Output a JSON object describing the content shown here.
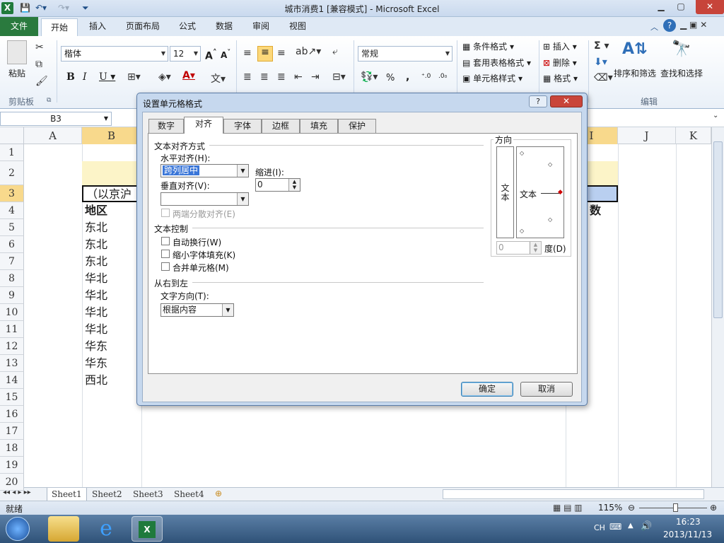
{
  "window": {
    "title": "城市消费1 [兼容模式] - Microsoft Excel",
    "minimize": "▁",
    "maximize": "▢",
    "close": "✕"
  },
  "ribbon_tabs": [
    "文件",
    "开始",
    "插入",
    "页面布局",
    "公式",
    "数据",
    "审阅",
    "视图"
  ],
  "ribbon": {
    "paste": "粘贴",
    "clipboard_group": "剪贴板",
    "font_name": "楷体",
    "font_size": "12",
    "number_format": "常规",
    "conditional_format": "条件格式",
    "table_format": "套用表格格式",
    "cell_style": "单元格样式",
    "insert": "插入",
    "delete": "删除",
    "format": "格式",
    "sort_filter": "排序和筛选",
    "find_select": "查找和选择",
    "edit_group": "编辑",
    "percent": "%",
    "comma": ","
  },
  "name_box": "B3",
  "columns": [
    "A",
    "B",
    "I",
    "J",
    "K"
  ],
  "rows": [
    "1",
    "2",
    "3",
    "4",
    "5",
    "6",
    "7",
    "8",
    "9",
    "10",
    "11",
    "12",
    "13",
    "14",
    "15",
    "16",
    "17",
    "18",
    "19",
    "20"
  ],
  "cells": {
    "b3": "（以京沪",
    "b4": "地区",
    "i4": "数",
    "regions": [
      "东北",
      "东北",
      "东北",
      "华北",
      "华北",
      "华北",
      "华北",
      "华东",
      "华东",
      "西北"
    ]
  },
  "dialog": {
    "title": "设置单元格格式",
    "help": "?",
    "close": "✕",
    "tabs": [
      "数字",
      "对齐",
      "字体",
      "边框",
      "填充",
      "保护"
    ],
    "active_tab": "对齐",
    "text_alignment_section": "文本对齐方式",
    "horizontal_label": "水平对齐(H):",
    "horizontal_value": "跨列居中",
    "indent_label": "缩进(I):",
    "indent_value": "0",
    "vertical_label": "垂直对齐(V):",
    "vertical_value": "",
    "distributed_label": "两端分散对齐(E)",
    "text_control_section": "文本控制",
    "wrap_text": "自动换行(W)",
    "shrink_to_fit": "缩小字体填充(K)",
    "merge_cells": "合并单元格(M)",
    "rtl_section": "从右到左",
    "text_direction_label": "文字方向(T):",
    "text_direction_value": "根据内容",
    "orientation_section": "方向",
    "vertical_text": "文本",
    "orientation_text": "文本",
    "degrees_value": "0",
    "degrees_label": "度(D)",
    "ok": "确定",
    "cancel": "取消"
  },
  "sheets": [
    "Sheet1",
    "Sheet2",
    "Sheet3",
    "Sheet4"
  ],
  "status": {
    "ready": "就绪",
    "zoom": "115%"
  },
  "taskbar": {
    "lang": "CH",
    "time": "16:23",
    "date": "2013/11/13"
  }
}
